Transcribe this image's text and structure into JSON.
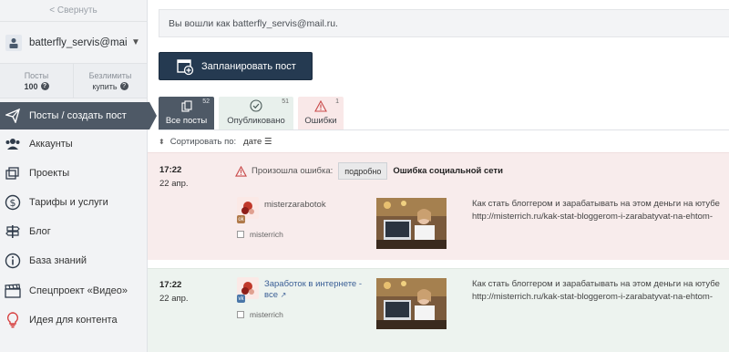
{
  "sidebar": {
    "collapse_label": "< Свернуть",
    "account_name": "batterfly_servis@mail.ru",
    "stats": [
      {
        "label": "Посты",
        "value": "100"
      },
      {
        "label": "Безлимиты",
        "value": "купить"
      }
    ],
    "items": [
      {
        "label": "Посты / создать пост",
        "icon": "paper-plane-icon",
        "active": true
      },
      {
        "label": "Аккаунты",
        "icon": "users-icon"
      },
      {
        "label": "Проекты",
        "icon": "projects-icon"
      },
      {
        "label": "Тарифы и услуги",
        "icon": "dollar-icon"
      },
      {
        "label": "Блог",
        "icon": "signpost-icon"
      },
      {
        "label": "База знаний",
        "icon": "info-icon"
      },
      {
        "label": "Спецпроект «Видео»",
        "icon": "clapperboard-icon"
      },
      {
        "label": "Идея для контента",
        "icon": "lightbulb-icon"
      }
    ]
  },
  "notice": "Вы вошли как batterfly_servis@mail.ru.",
  "plan_button": "Запланировать пост",
  "tabs": [
    {
      "label": "Все посты",
      "count": "52",
      "icon": "copy-icon",
      "active": true
    },
    {
      "label": "Опубликовано",
      "count": "51",
      "icon": "check-circle-icon"
    },
    {
      "label": "Ошибки",
      "count": "1",
      "icon": "warning-icon"
    }
  ],
  "sort": {
    "label": "Сортировать по:",
    "field": "дате"
  },
  "posts": [
    {
      "time": "17:22",
      "date": "22 апр.",
      "error_label": "Произошла ошибка:",
      "detail_button": "подробно",
      "error_title": "Ошибка социальной сети",
      "account": "misterzarabotok",
      "network": "ok",
      "checkbox_label": "misterrich",
      "text_line1": "Как стать блоггером и зарабатывать на этом деньги на ютубе",
      "text_line2": "http://misterrich.ru/kak-stat-bloggerom-i-zarabatyvat-na-ehtom-",
      "status": "error"
    },
    {
      "time": "17:22",
      "date": "22 апр.",
      "account_line1": "Заработок в интернете -",
      "account_line2": "все",
      "network": "vk",
      "checkbox_label": "misterrich",
      "text_line1": "Как стать блоггером и зарабатывать на этом деньги на ютубе",
      "text_line2": "http://misterrich.ru/kak-stat-bloggerom-i-zarabatyvat-na-ehtom-",
      "status": "published"
    }
  ],
  "colors": {
    "active_nav": "#4e5966",
    "plan_button": "#253a51",
    "error_bg": "#f8ecec",
    "published_bg": "#edf3ef"
  }
}
